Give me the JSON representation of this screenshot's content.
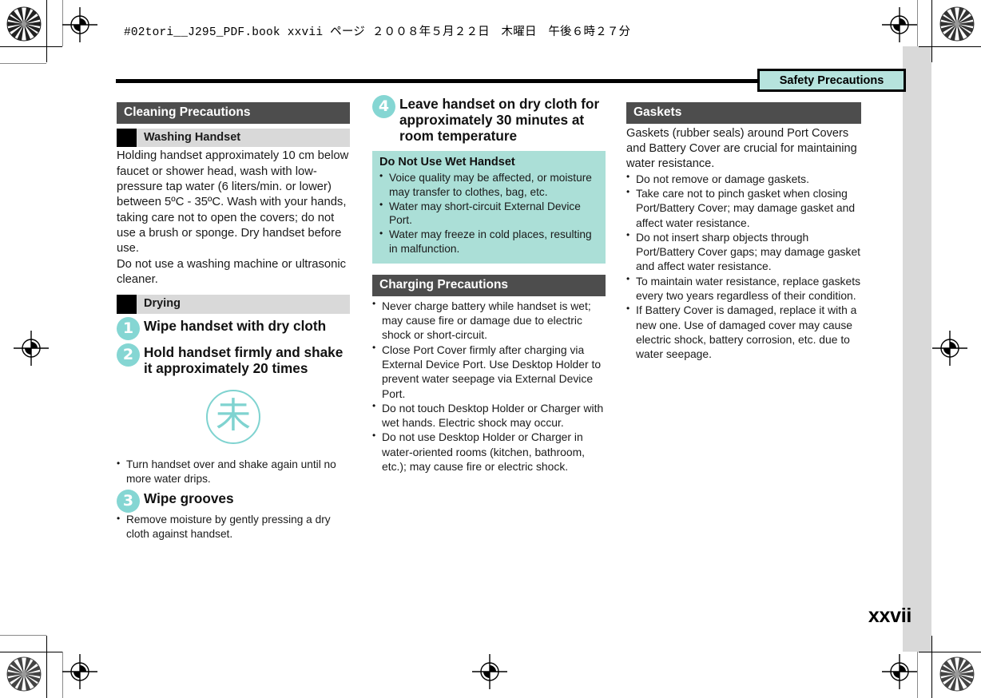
{
  "header_line": "#02tori__J295_PDF.book   xxvii ページ   ２００８年５月２２日　木曜日　午後６時２７分",
  "tab_label": "Safety Precautions",
  "page_number": "xxvii",
  "colors": {
    "section_bar": "#4d4d4d",
    "sub_bar": "#d9d9d9",
    "accent_cyan": "#85d6d3",
    "note_box": "#abdfd7",
    "tab_fill": "#b6e3dd"
  },
  "column_left": {
    "section_title": "Cleaning Precautions",
    "sub_title": "Washing Handset",
    "paragraph": "Holding handset approximately 10 cm below faucet or shower head, wash with low-pressure tap water (6 liters/min. or lower) between 5ºC - 35ºC. Wash with your hands, taking care not to open the covers; do not use a brush or sponge. Dry handset before use.\nDo not use a washing machine or ultrasonic cleaner.",
    "sub_title_2": "Drying",
    "steps": [
      {
        "num": "1",
        "text": "Wipe handset with dry cloth"
      },
      {
        "num": "2",
        "text": "Hold handset firmly and shake it approximately 20 times"
      },
      {
        "num": "3",
        "text": "Wipe grooves"
      }
    ],
    "figure_glyph": "未",
    "step2_bullets": [
      "Turn handset over and shake again until no more water drips."
    ],
    "step3_bullets": [
      "Remove moisture by gently pressing a dry cloth against handset."
    ]
  },
  "column_middle": {
    "step4": {
      "num": "4",
      "text": "Leave handset on dry cloth for approximately 30 minutes at room temperature"
    },
    "note_title": "Do Not Use Wet Handset",
    "note_bullets": [
      "Voice quality may be affected, or moisture may transfer to clothes, bag, etc.",
      "Water may short-circuit External Device Port.",
      "Water may freeze in cold places, resulting in malfunction."
    ],
    "section_title": "Charging Precautions",
    "bullets": [
      "Never charge battery while handset is wet; may cause fire or damage due to electric shock or short-circuit.",
      "Close Port Cover firmly after charging via External Device Port. Use Desktop Holder to prevent water seepage via External Device Port.",
      "Do not touch Desktop Holder or Charger with wet hands. Electric shock may occur.",
      "Do not use Desktop Holder or Charger in water-oriented rooms (kitchen, bathroom, etc.); may cause fire or electric shock."
    ]
  },
  "column_right": {
    "section_title": "Gaskets",
    "paragraph": "Gaskets (rubber seals) around Port Covers and Battery Cover are crucial for maintaining water resistance.",
    "bullets": [
      "Do not remove or damage gaskets.",
      "Take care not to pinch gasket when closing Port/Battery Cover; may damage gasket and affect water resistance.",
      "Do not insert sharp objects through Port/Battery Cover gaps; may damage gasket and affect water resistance.",
      "To maintain water resistance, replace gaskets every two years regardless of their condition.",
      "If Battery Cover is damaged, replace it with a new one. Use of damaged cover may cause electric shock, battery corrosion, etc. due to water seepage."
    ]
  }
}
